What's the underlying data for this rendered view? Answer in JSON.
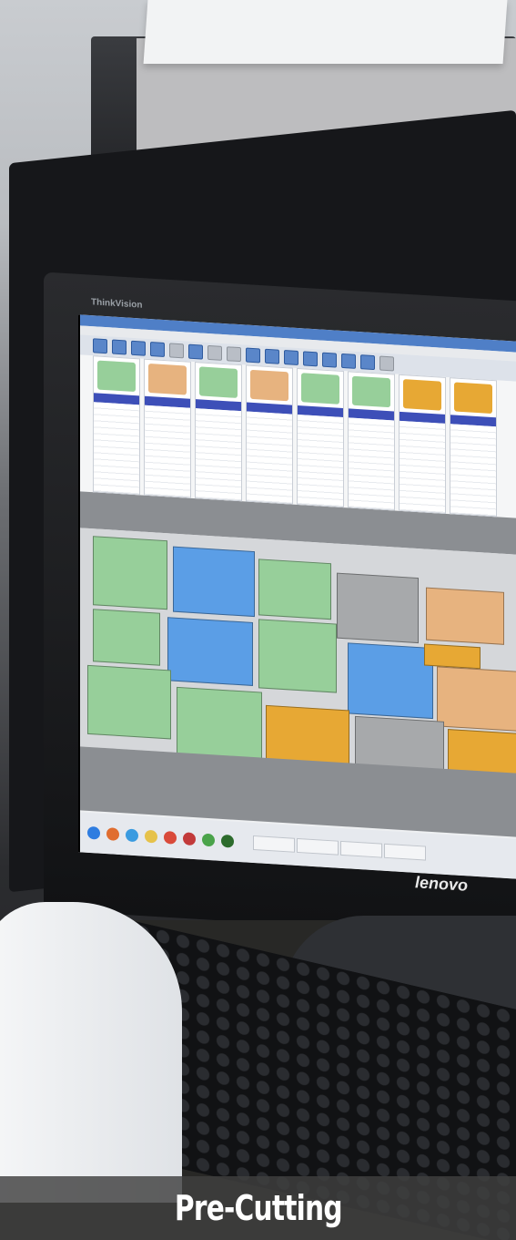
{
  "caption": "Pre-Cutting",
  "monitor_model": "ThinkVision",
  "monitor_brand": "lenovo",
  "colors": {
    "caption_bar": "#404040",
    "piece_green": "#97cf9a",
    "piece_blue": "#5b9ee6",
    "piece_orange": "#e7a834",
    "piece_grey": "#a7a9ab",
    "piece_tan": "#e7b37f"
  }
}
